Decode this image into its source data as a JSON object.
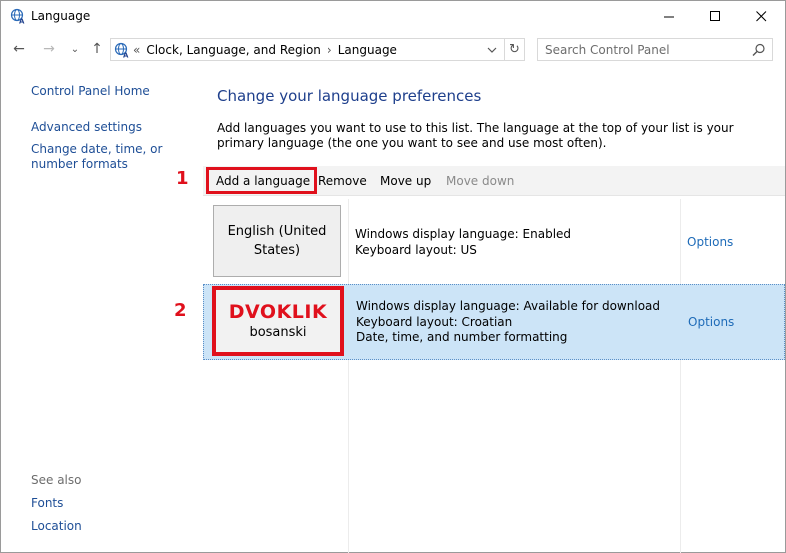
{
  "window": {
    "title": "Language",
    "minimize": "—",
    "maximize": "☐",
    "close": "✕"
  },
  "nav": {
    "back": "←",
    "forward": "→",
    "recent": "⌄",
    "up": "↑",
    "address_prefix": "«",
    "breadcrumb": [
      "Clock, Language, and Region",
      "Language"
    ],
    "breadcrumb_sep": "›",
    "refresh": "↻",
    "search_placeholder": "Search Control Panel"
  },
  "sidebar": {
    "home": "Control Panel Home",
    "advanced": "Advanced settings",
    "change_date": "Change date, time, or number formats",
    "see_also": "See also",
    "fonts": "Fonts",
    "location": "Location"
  },
  "main": {
    "heading": "Change your language preferences",
    "description": "Add languages you want to use to this list. The language at the top of your list is your primary language (the one you want to see and use most often)."
  },
  "toolbar": {
    "add": "Add a language",
    "remove": "Remove",
    "move_up": "Move up",
    "move_down": "Move down"
  },
  "annotations": {
    "marker_1": "1",
    "marker_2": "2",
    "overlay_text": "DVOKLIK",
    "color": "#e0101c"
  },
  "languages": [
    {
      "name": "English (United States)",
      "display": "Windows display language: Enabled",
      "keyboard": "Keyboard layout: US",
      "formatting": "",
      "options": "Options"
    },
    {
      "name": "bosanski",
      "display": "Windows display language: Available for download",
      "keyboard": "Keyboard layout: Croatian",
      "formatting": "Date, time, and number formatting",
      "options": "Options"
    }
  ]
}
